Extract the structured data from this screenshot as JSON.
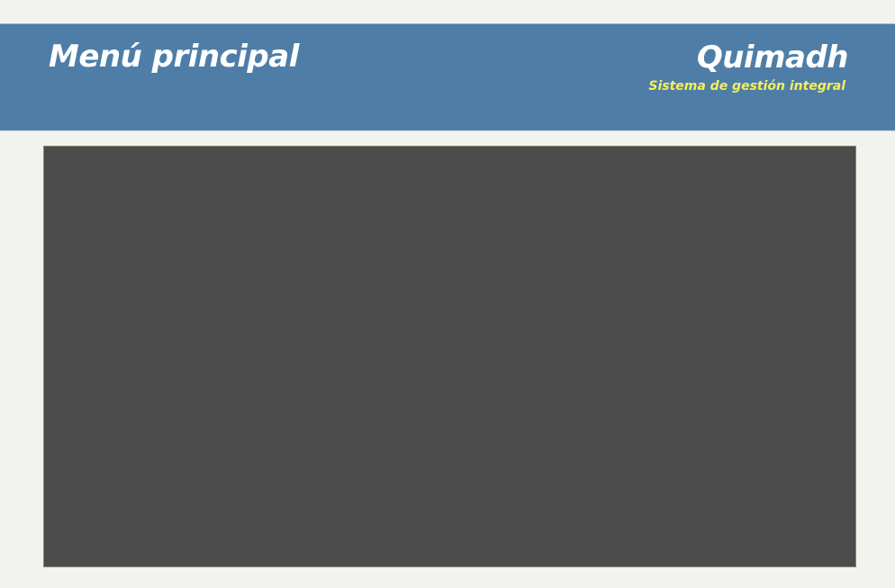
{
  "header": {
    "title": "Menú principal",
    "brand_name": "Quimadh",
    "tagline": "Sistema de gestión integral"
  },
  "colors": {
    "header_bg": "#4e7ea8",
    "title_text": "#ffffff",
    "tagline_text": "#f5ef5a",
    "content_bg": "#4c4c4c",
    "page_bg": "#f2f2ee"
  }
}
